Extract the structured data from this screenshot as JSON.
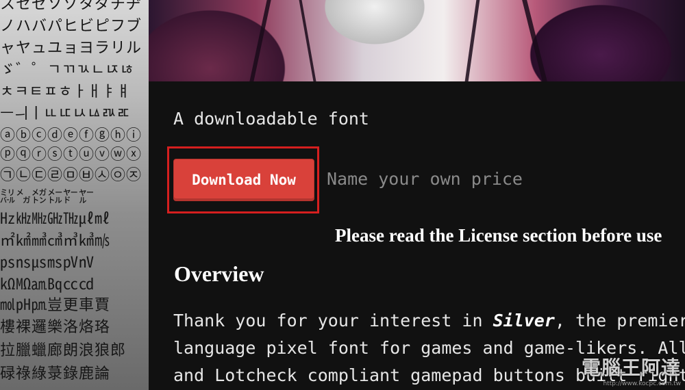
{
  "glyph_panel": {
    "rows": [
      "スセゼソゾタダチヂ",
      "ノハバパヒビピフブ",
      "ャヤュユョヨラリル",
      "ゞ゛゜ㄱㄲㄳㄴㄵㄶ",
      "ㅊㅋㅌㅍㅎㅏㅐㅑㅒ",
      "ㅡㅢㅣㅥㅦㅧㅨㅩㅪ",
      "ⓐⓑⓒⓓⓔⓕⓖⓗⓘ",
      "ⓟⓠⓡⓢⓣⓤⓥⓦⓧ",
      "㉠㉡㉢㉣㉤㉥㉦㉧㉨",
      "㍊㍋㍌㍍㍎㍏",
      "㎐㎑㎒㎓㎔㎕㎖",
      "㎡㎢㎣㎤㎥㎦㎧",
      "㎰㎱㎲㎳㎴㎵",
      "㏀㏁㏂㏃㏄㏅",
      "㏖㏗㏘豈更車賈",
      "樓裸邏樂洛烙珞",
      "拉臘蠟廊朗浪狼郎",
      "碌祿綠菉錄鹿論"
    ]
  },
  "content": {
    "tagline": "A downloadable font",
    "download_button_label": "Download Now",
    "price_text": "Name your own price",
    "license_note": "Please read the License section before use",
    "overview_heading": "Overview",
    "paragraph": {
      "line1_before": "Thank you for your interest in ",
      "line1_em": "Silver",
      "line1_after": ", the premier multi-",
      "line2": "language pixel font for games and game-likers. All-",
      "line3": "and Lotcheck compliant gamepad buttons built right in"
    }
  },
  "watermark": {
    "logo_text": "電腦王阿達",
    "url": "http://www.kocpc.com.tw"
  },
  "colors": {
    "content_bg": "#111111",
    "button_bg": "#d9413a",
    "highlight_border": "#d61f1f",
    "price_text": "#8a8a8a"
  }
}
